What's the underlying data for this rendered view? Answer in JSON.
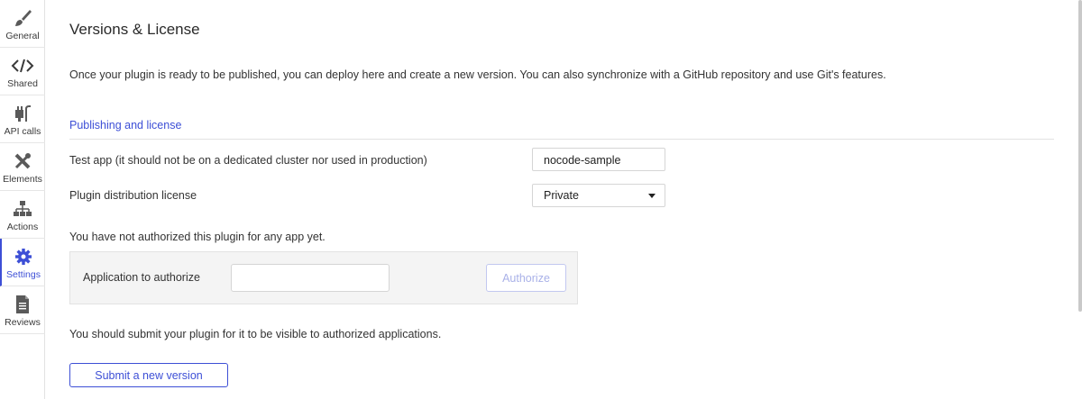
{
  "sidebar": {
    "items": [
      {
        "label": "General",
        "icon": "paintbrush-icon"
      },
      {
        "label": "Shared",
        "icon": "code-icon"
      },
      {
        "label": "API calls",
        "icon": "plug-icon"
      },
      {
        "label": "Elements",
        "icon": "tools-icon"
      },
      {
        "label": "Actions",
        "icon": "workflow-icon"
      },
      {
        "label": "Settings",
        "icon": "gear-icon",
        "active": true
      },
      {
        "label": "Reviews",
        "icon": "document-icon"
      }
    ]
  },
  "main": {
    "title": "Versions & License",
    "intro": "Once your plugin is ready to be published, you can deploy here and create a new version. You can also synchronize with a GitHub repository and use Git's features.",
    "section_title": "Publishing and license",
    "test_app": {
      "label": "Test app (it should not be on a dedicated cluster nor used in production)",
      "value": "nocode-sample"
    },
    "license": {
      "label": "Plugin distribution license",
      "value": "Private"
    },
    "not_authorized": "You have not authorized this plugin for any app yet.",
    "authorize": {
      "label": "Application to authorize",
      "input_value": "",
      "button_label": "Authorize"
    },
    "submit_note": "You should submit your plugin for it to be visible to authorized applications.",
    "submit_button": "Submit a new version"
  },
  "colors": {
    "accent": "#3d4fd6",
    "icon": "#5a5a5a",
    "disabled": "#a9b1e8"
  }
}
